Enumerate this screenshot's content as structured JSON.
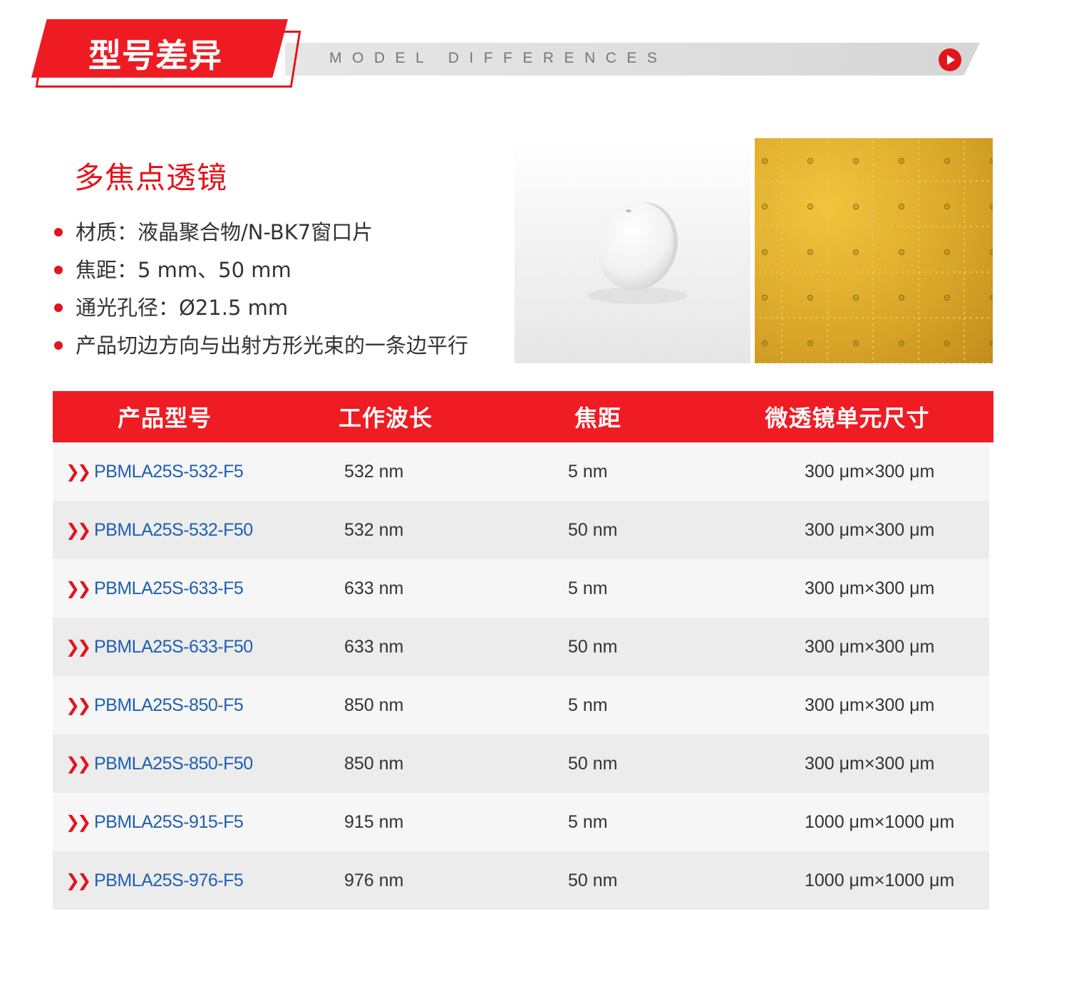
{
  "banner": {
    "title": "型号差异",
    "subtitle": "MODEL DIFFERENCES",
    "play_icon": "play-circle-icon"
  },
  "product": {
    "title": "多焦点透镜",
    "specs": [
      "材质：液晶聚合物/N-BK7窗口片",
      "焦距：5 mm、50 mm",
      "通光孔径：Ø21.5 mm",
      "产品切边方向与出射方形光束的一条边平行"
    ]
  },
  "table": {
    "headers": [
      "产品型号",
      "工作波长",
      "焦距",
      "微透镜单元尺寸"
    ],
    "rows": [
      {
        "model": "PBMLA25S-532-F5",
        "wavelength": "532 nm",
        "focal": "5 nm",
        "size": "300 μm×300  μm"
      },
      {
        "model": "PBMLA25S-532-F50",
        "wavelength": "532 nm",
        "focal": "50 nm",
        "size": "300 μm×300 μm"
      },
      {
        "model": "PBMLA25S-633-F5",
        "wavelength": "633 nm",
        "focal": "5 nm",
        "size": "300 μm×300  μm"
      },
      {
        "model": "PBMLA25S-633-F50",
        "wavelength": "633 nm",
        "focal": "50 nm",
        "size": "300 μm×300  μm"
      },
      {
        "model": "PBMLA25S-850-F5",
        "wavelength": "850 nm",
        "focal": "5 nm",
        "size": "300 μm×300  μm"
      },
      {
        "model": "PBMLA25S-850-F50",
        "wavelength": "850 nm",
        "focal": "50 nm",
        "size": "300 μm×300  μm"
      },
      {
        "model": "PBMLA25S-915-F5",
        "wavelength": "915 nm",
        "focal": "5 nm",
        "size": "1000 μm×1000 μm"
      },
      {
        "model": "PBMLA25S-976-F5",
        "wavelength": "976 nm",
        "focal": "50 nm",
        "size": "1000 μm×1000 μm"
      }
    ]
  },
  "colors": {
    "accent": "#e3141c",
    "link": "#1f5fb0"
  }
}
